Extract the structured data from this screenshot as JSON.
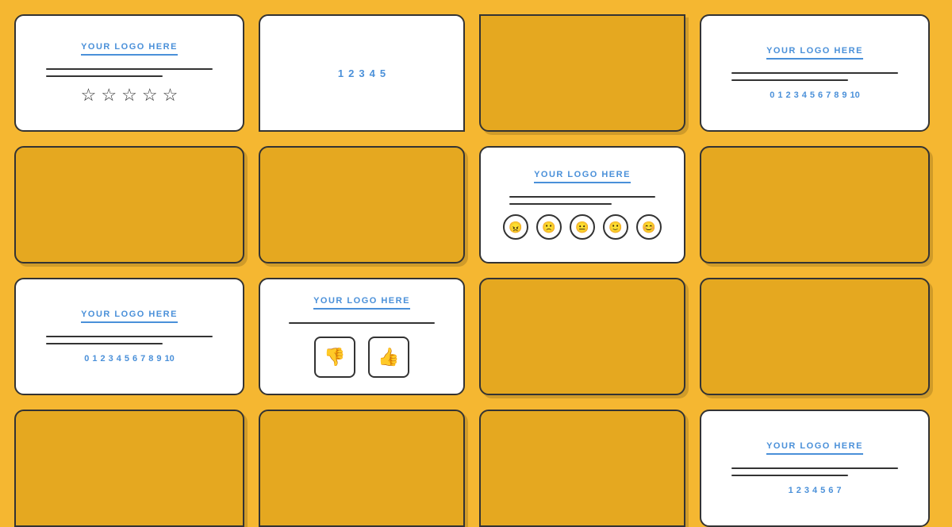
{
  "background_color": "#F5B731",
  "cards": [
    {
      "id": "r1c1",
      "type": "star-rating",
      "logo": "YOUR LOGO HERE",
      "stars_count": 5,
      "lines": 2
    },
    {
      "id": "r1c2",
      "type": "nps-1-5",
      "numbers": [
        "1",
        "2",
        "3",
        "4",
        "5"
      ]
    },
    {
      "id": "r1c3",
      "type": "yellow-plain"
    },
    {
      "id": "r1c4",
      "type": "nps-0-10",
      "logo": "YOUR LOGO HERE",
      "numbers": [
        "0",
        "1",
        "2",
        "3",
        "4",
        "5",
        "6",
        "7",
        "8",
        "9",
        "10"
      ],
      "lines": 2
    },
    {
      "id": "r2c1",
      "type": "yellow-plain"
    },
    {
      "id": "r2c2",
      "type": "yellow-plain"
    },
    {
      "id": "r2c3",
      "type": "emoji-rating",
      "logo": "YOUR LOGO HERE",
      "lines": 2
    },
    {
      "id": "r2c4",
      "type": "yellow-plain"
    },
    {
      "id": "r3c1",
      "type": "nps-0-10-partial",
      "logo": "YOUR LOGO HERE",
      "numbers": [
        "0",
        "1",
        "2",
        "3",
        "4",
        "5",
        "6",
        "7",
        "8",
        "9",
        "10"
      ],
      "lines": 2
    },
    {
      "id": "r3c2",
      "type": "thumbs-rating",
      "logo": "YOUR LOGO HERE",
      "lines": 1
    },
    {
      "id": "r3c3",
      "type": "yellow-plain"
    },
    {
      "id": "r3c4",
      "type": "yellow-plain"
    },
    {
      "id": "r4c1",
      "type": "yellow-plain"
    },
    {
      "id": "r4c2",
      "type": "yellow-plain"
    },
    {
      "id": "r4c3",
      "type": "yellow-plain"
    },
    {
      "id": "r4c4",
      "type": "nps-partial",
      "logo": "YOUR LOGO HERE",
      "numbers": [
        "1",
        "2",
        "3",
        "4",
        "5",
        "6",
        "7"
      ],
      "lines": 2
    }
  ],
  "labels": {
    "logo_text": "YOUR LOGO HERE"
  }
}
